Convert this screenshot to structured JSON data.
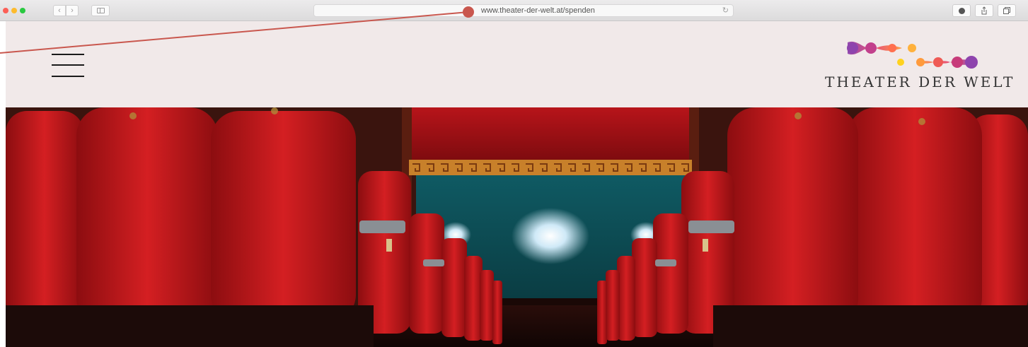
{
  "browser": {
    "url": "www.theater-der-welt.at/spenden",
    "reload_icon": "↻",
    "back_icon": "‹",
    "forward_icon": "›"
  },
  "site": {
    "logo_text": "THEATER DER WELT",
    "menu_icon": "hamburger-icon"
  },
  "hero": {
    "image_subject": "theater-seats-stage"
  },
  "colors": {
    "header_bg": "#f1e9e9",
    "annotation": "#c9574e",
    "logo_gradient": [
      "#8e44ad",
      "#e84a6f",
      "#ff9a3c",
      "#ffd21f"
    ]
  }
}
